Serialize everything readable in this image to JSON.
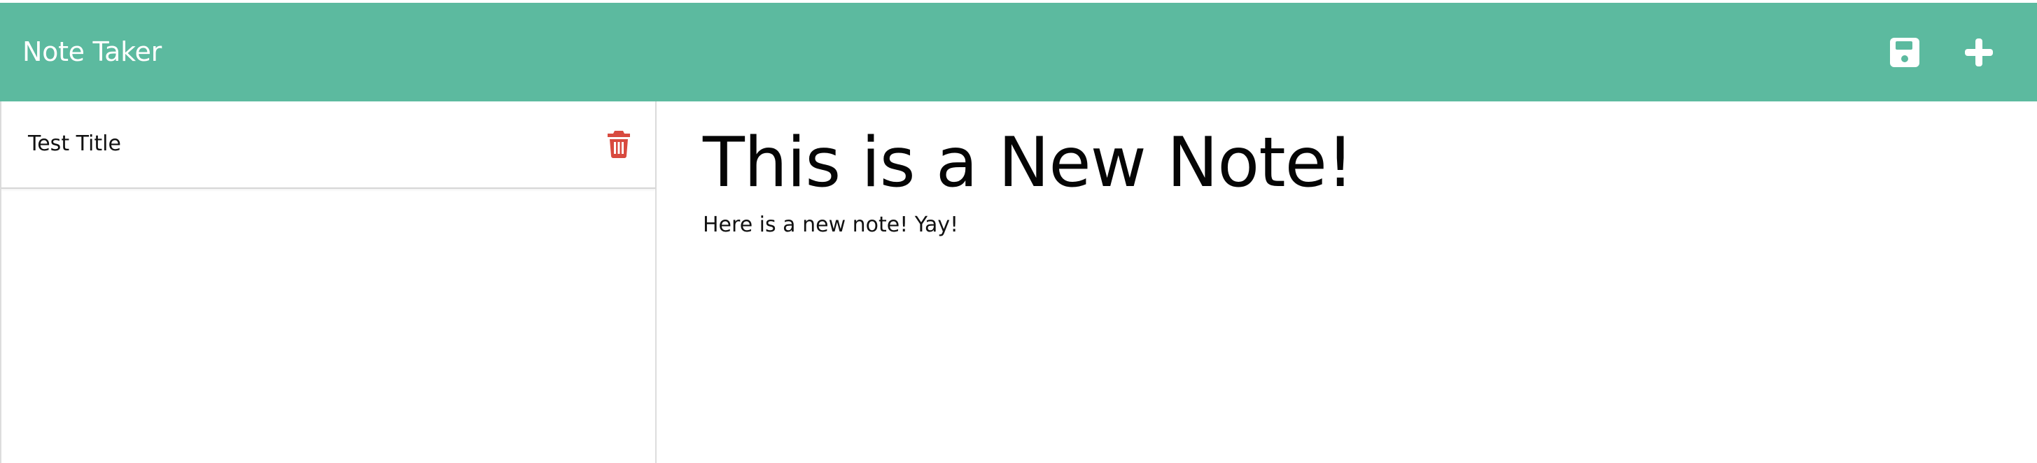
{
  "app": {
    "title": "Note Taker"
  },
  "navbar": {
    "background": "#5cba9f",
    "save_icon": "save-icon",
    "new_icon": "plus-icon"
  },
  "sidebar": {
    "notes": [
      {
        "title": "Test Title",
        "delete_icon": "trash-icon",
        "delete_color": "#d84a3f"
      }
    ]
  },
  "editor": {
    "title": "This is a New Note!",
    "body": "Here is a new note! Yay!"
  }
}
